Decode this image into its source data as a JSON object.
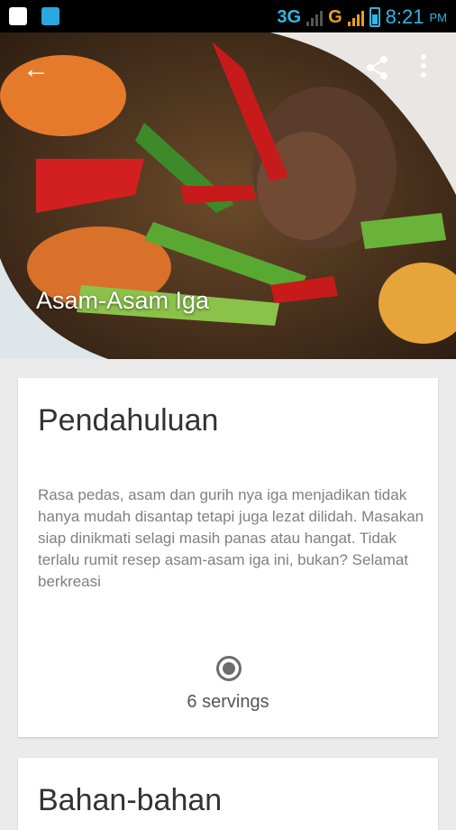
{
  "status_bar": {
    "network_3g": "3G",
    "network_g": "G",
    "time": "8:21",
    "ampm": "PM"
  },
  "hero": {
    "title": "Asam-Asam Iga",
    "back_icon": "arrow-left",
    "share_icon": "share",
    "more_icon": "more-vert"
  },
  "intro_card": {
    "title": "Pendahuluan",
    "description": "Rasa pedas, asam dan gurih nya iga menjadikan tidak hanya mudah disantap tetapi juga lezat dilidah. Masakan siap dinikmati selagi masih panas atau hangat. Tidak terlalu rumit resep asam-asam iga ini, bukan? Selamat berkreasi",
    "servings": "6 servings"
  },
  "ingredients_card": {
    "title": "Bahan-bahan"
  },
  "colors": {
    "accent": "#33b5e5",
    "background": "#ebebeb"
  }
}
